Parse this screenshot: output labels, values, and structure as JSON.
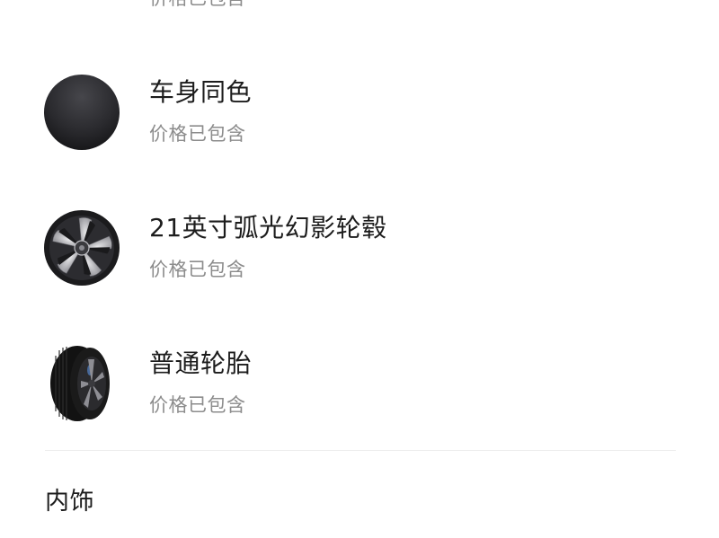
{
  "options": [
    {
      "title": "",
      "subtitle": "价格已包含",
      "thumb_icon": "black-wheel-cap-icon",
      "color": "#1e1e21"
    },
    {
      "title": "车身同色",
      "subtitle": "价格已包含",
      "thumb_icon": "color-swatch-icon",
      "color": "#2a2a2e"
    },
    {
      "title": "21英寸弧光幻影轮毂",
      "subtitle": "价格已包含",
      "thumb_icon": "alloy-wheel-icon",
      "color": "#3a3a3e"
    },
    {
      "title": "普通轮胎",
      "subtitle": "价格已包含",
      "thumb_icon": "tire-icon",
      "color": "#151515"
    }
  ],
  "section": {
    "title": "内饰"
  },
  "colors": {
    "title_text": "#1c1c1c",
    "sub_text": "#8c8c8c",
    "divider": "#ececec"
  }
}
